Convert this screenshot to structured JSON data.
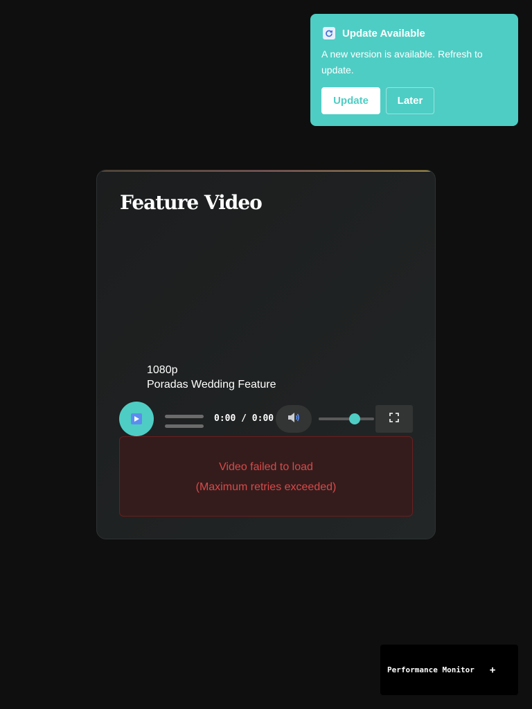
{
  "toast": {
    "icon": "refresh-icon",
    "title": "Update Available",
    "message": "A new version is available. Refresh to update.",
    "update_label": "Update",
    "later_label": "Later",
    "accent": "#4ecdc4"
  },
  "player": {
    "title": "Feature Video",
    "quality": "1080p",
    "video_title": "Poradas Wedding Feature",
    "time": "0:00 / 0:00",
    "volume": 0.65,
    "error_line1": "Video failed to load",
    "error_line2": "(Maximum retries exceeded)",
    "icons": {
      "play": "play-icon",
      "volume": "speaker-icon",
      "fullscreen": "fullscreen-icon"
    }
  },
  "perf_monitor": {
    "label": "Performance Monitor",
    "toggle": "+"
  }
}
